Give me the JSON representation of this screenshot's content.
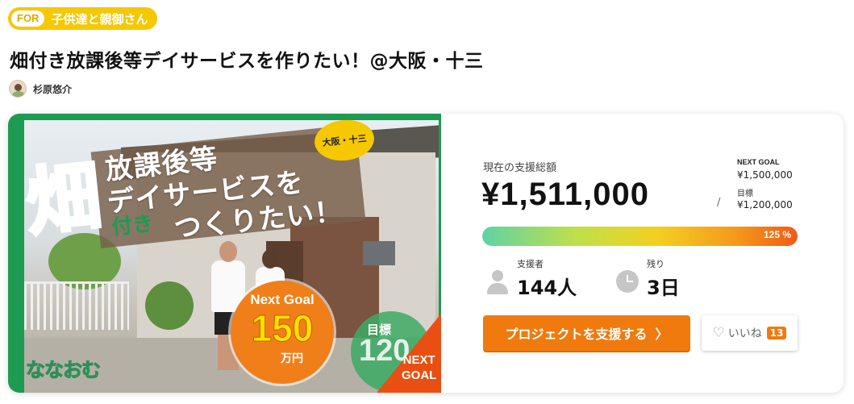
{
  "category": {
    "for_tag": "FOR",
    "label": "子供達と親御さん"
  },
  "project": {
    "title": "畑付き放課後等デイサービスを作りたい！@大阪・十三",
    "author": "杉原悠介"
  },
  "hero": {
    "big_kanji": "畑",
    "line1": "放課後等",
    "line2": "デイサービスを",
    "line3": "つくりたい！",
    "tsuki": "付き",
    "bubble": "大阪・十三",
    "goal_label": "Next Goal",
    "goal_number": "150",
    "goal_unit": "万円",
    "target_label": "目標",
    "target_number": "120",
    "corner_text": "NEXT GOAL",
    "logo_text": "ななおむ"
  },
  "funding": {
    "raised_label": "現在の支援総額",
    "raised_amount": "¥1,511,000",
    "next_goal_label": "NEXT GOAL",
    "next_goal_value": "¥1,500,000",
    "target_label": "目標",
    "target_value": "¥1,200,000",
    "separator": "/",
    "progress_percent": 125,
    "progress_text": "125 %",
    "supporters_label": "支援者",
    "supporters_value": "144人",
    "remaining_label": "残り",
    "remaining_value": "3日"
  },
  "actions": {
    "support_button": "プロジェクトを支援する",
    "support_chevron": "〉",
    "like_label": "いいね",
    "like_count": "13"
  },
  "colors": {
    "brand_orange": "#f07a0e",
    "badge_yellow": "#f5c800",
    "hero_green": "#1e9a52"
  }
}
